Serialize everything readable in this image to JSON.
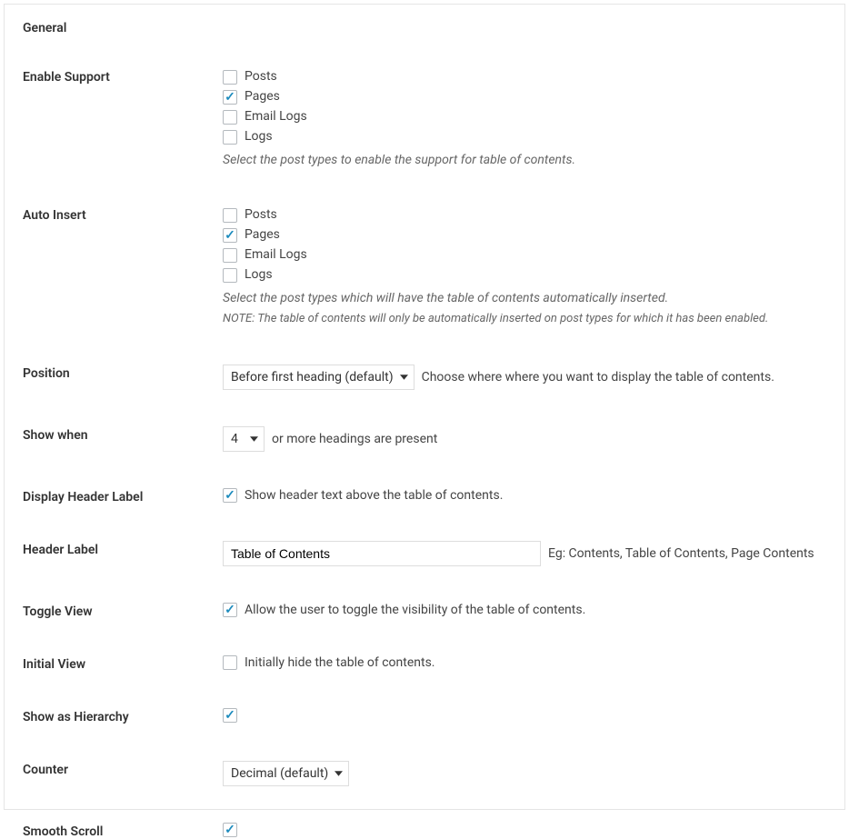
{
  "section_title": "General",
  "enable_support": {
    "label": "Enable Support",
    "options": [
      {
        "label": "Posts",
        "checked": false
      },
      {
        "label": "Pages",
        "checked": true
      },
      {
        "label": "Email Logs",
        "checked": false
      },
      {
        "label": "Logs",
        "checked": false
      }
    ],
    "description": "Select the post types to enable the support for table of contents."
  },
  "auto_insert": {
    "label": "Auto Insert",
    "options": [
      {
        "label": "Posts",
        "checked": false
      },
      {
        "label": "Pages",
        "checked": true
      },
      {
        "label": "Email Logs",
        "checked": false
      },
      {
        "label": "Logs",
        "checked": false
      }
    ],
    "description": "Select the post types which will have the table of contents automatically inserted.",
    "note": "NOTE: The table of contents will only be automatically inserted on post types for which it has been enabled."
  },
  "position": {
    "label": "Position",
    "value": "Before first heading (default)",
    "hint": "Choose where where you want to display the table of contents."
  },
  "show_when": {
    "label": "Show when",
    "value": "4",
    "hint": "or more headings are present"
  },
  "display_header_label": {
    "label": "Display Header Label",
    "checked": true,
    "text": "Show header text above the table of contents."
  },
  "header_label": {
    "label": "Header Label",
    "value": "Table of Contents",
    "hint": "Eg: Contents, Table of Contents, Page Contents"
  },
  "toggle_view": {
    "label": "Toggle View",
    "checked": true,
    "text": "Allow the user to toggle the visibility of the table of contents."
  },
  "initial_view": {
    "label": "Initial View",
    "checked": false,
    "text": "Initially hide the table of contents."
  },
  "show_hierarchy": {
    "label": "Show as Hierarchy",
    "checked": true
  },
  "counter": {
    "label": "Counter",
    "value": "Decimal (default)"
  },
  "smooth_scroll": {
    "label": "Smooth Scroll",
    "checked": true
  }
}
